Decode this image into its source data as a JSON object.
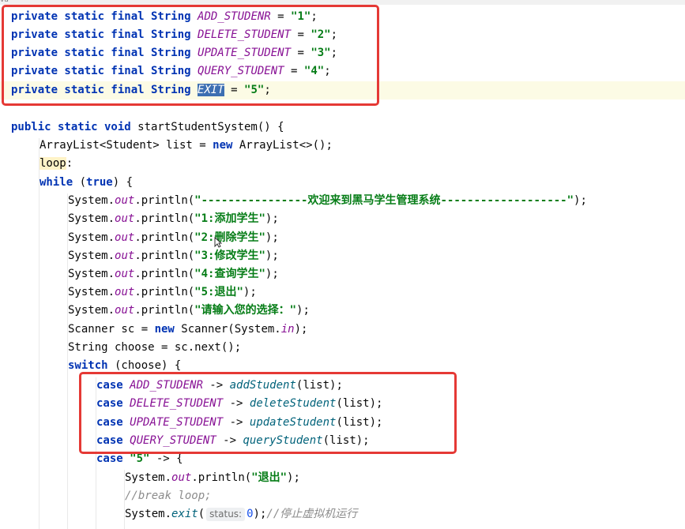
{
  "window": {
    "tab_label_fragment": "va"
  },
  "hint": {
    "status_label": "status:"
  },
  "constants": [
    {
      "prefix": "private static final String ",
      "name": "ADD_STUDENR",
      "assign": " = ",
      "value": "\"1\"",
      "end": ";"
    },
    {
      "prefix": "private static final String ",
      "name": "DELETE_STUDENT",
      "assign": " = ",
      "value": "\"2\"",
      "end": ";"
    },
    {
      "prefix": "private static final String ",
      "name": "UPDATE_STUDENT",
      "assign": " = ",
      "value": "\"3\"",
      "end": ";"
    },
    {
      "prefix": "private static final String ",
      "name": "QUERY_STUDENT",
      "assign": " = ",
      "value": "\"4\"",
      "end": ";"
    },
    {
      "prefix": "private static final String ",
      "name": "EXIT",
      "assign": " = ",
      "value": "\"5\"",
      "end": ";"
    }
  ],
  "method": {
    "signature_kw": "public static void",
    "signature_rest": " startStudentSystem() {",
    "list_decl_a": "ArrayList<Student> list = ",
    "list_decl_new": "new",
    "list_decl_b": " ArrayList<>();",
    "loop_label": "loop",
    "loop_colon": ":",
    "while_kw": "while",
    "while_open": " (",
    "while_true": "true",
    "while_close": ") {",
    "printlns": [
      "\"----------------欢迎来到黑马学生管理系统-------------------\"",
      "\"1:添加学生\"",
      "\"2:删除学生\"",
      "\"3:修改学生\"",
      "\"4:查询学生\"",
      "\"5:退出\"",
      "\"请输入您的选择：\""
    ],
    "system": "System.",
    "out": "out",
    "println_call": ".println(",
    "println_end": ");",
    "scanner_a": "Scanner sc = ",
    "scanner_new": "new",
    "scanner_b": " Scanner(System.",
    "scanner_in": "in",
    "scanner_c": ");",
    "choose_line": "String choose = sc.next();",
    "switch_kw": "switch",
    "switch_rest": " (choose) {",
    "cases": [
      {
        "kw": "case",
        "const": "ADD_STUDENR",
        "arrow": " -> ",
        "call": "addStudent",
        "args": "(list);"
      },
      {
        "kw": "case",
        "const": "DELETE_STUDENT",
        "arrow": " -> ",
        "call": "deleteStudent",
        "args": "(list);"
      },
      {
        "kw": "case",
        "const": "UPDATE_STUDENT",
        "arrow": " -> ",
        "call": "updateStudent",
        "args": "(list);"
      },
      {
        "kw": "case",
        "const": "QUERY_STUDENT",
        "arrow": " -> ",
        "call": "queryStudent",
        "args": "(list);"
      }
    ],
    "case5_kw": "case",
    "case5_val": "\"5\"",
    "case5_rest": " -> {",
    "exit_println_str": "\"退出\"",
    "break_comment": "//break loop;",
    "exit_a": "System.",
    "exit_call": "exit",
    "exit_open": "(",
    "exit_arg": "0",
    "exit_end": ");",
    "exit_comment": "//停止虚拟机运行"
  },
  "colors": {
    "keyword": "#0033b3",
    "string": "#067d17",
    "constant": "#871094",
    "highlight_box": "#e53935"
  }
}
